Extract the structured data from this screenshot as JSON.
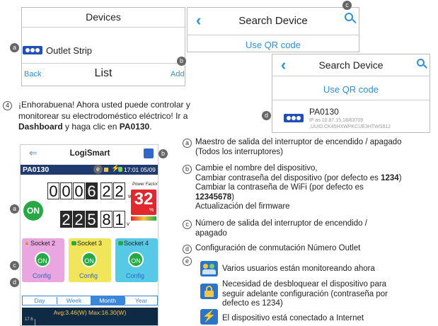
{
  "panel_devices": {
    "title": "Devices",
    "device_name": "Outlet Strip",
    "back_label": "Back",
    "list_title": "List",
    "add_label": "Add"
  },
  "panel_search1": {
    "title": "Search Device",
    "qr_label": "Use QR code"
  },
  "panel_search2": {
    "title": "Search Device",
    "qr_label": "Use QR code",
    "device_name": "PA0130",
    "ip_line": "IP as 10.87.15.18/63709",
    "uuid_line": ",UUID:CK45HXWPKCUE3HTWS81J"
  },
  "markers": {
    "a": "a",
    "b": "b",
    "c": "c",
    "d": "d",
    "e": "e",
    "step": "4"
  },
  "step4": {
    "line1": "¡Enhorabuena! Ahora usted puede controlar y",
    "line2": "monitorear su electrodoméstico eléctrico! Ir a",
    "bold1": "Dashboard",
    "mid": " y haga clic en ",
    "bold2": "PA0130",
    "end": "."
  },
  "phone": {
    "app_title": "LogiSmart",
    "device": "PA0130",
    "status_time": "17:01 05/09",
    "on_label": "ON",
    "power_digits": [
      "0",
      "0",
      "0",
      "6",
      "2",
      "2"
    ],
    "power_unit": "w",
    "voltage_digits": [
      "2",
      "2",
      "5",
      "8",
      "1"
    ],
    "voltage_unit": "v",
    "power_factor_label": "Power Factor",
    "power_factor_value": "32",
    "power_factor_unit": "%",
    "sockets": [
      {
        "label": "Socket 2",
        "state": "ON",
        "config": "Config",
        "color": "#e9a6e0"
      },
      {
        "label": "Socket 3",
        "state": "ON",
        "config": "Config",
        "color": "#f1e65a"
      },
      {
        "label": "Socket 4",
        "state": "ON",
        "config": "Config",
        "color": "#56c9e6"
      }
    ],
    "tabs": [
      "Day",
      "Week",
      "Month",
      "Year"
    ],
    "active_tab": "Month",
    "chart_stats": "Avg:3.46(W)  Max:16.30(W)",
    "chart_tick": "17.6"
  },
  "legend": {
    "a": {
      "l1": "Maestro de salida del interruptor de encendido / apagado",
      "l2": "(Todos los interruptores)"
    },
    "b": {
      "l1": "Cambie el nombre del dispositivo,",
      "l2a": "Cambiar contraseña del dispositivo (por defecto es ",
      "l2b": "1234",
      "l2c": ")",
      "l3": "Cambiar la contraseña de WiFi (por defecto es",
      "l4": "12345678",
      "l4b": ")",
      "l5": "Actualización del firmware"
    },
    "c": {
      "l1": "Número de salida del interruptor de encendido /",
      "l2": "apagado"
    },
    "d": {
      "l1": "Configuración de conmutación Número Outlet"
    },
    "e1": "Varios usuarios están monitoreando ahora",
    "e2": {
      "l1": "Necesidad de desbloquear el dispositivo para",
      "l2": "seguir adelante configuración (contraseña por",
      "l3": "defecto es 1234)"
    },
    "e3": "El dispositivo está conectado a Internet"
  },
  "colors": {
    "accent_blue": "#2f8fd8",
    "strip_blue": "#1f4fb8",
    "on_green": "#27a845",
    "header_navy": "#1e3a6e",
    "pf_red": "#e0282e",
    "chart_bg": "#0f2a45"
  }
}
